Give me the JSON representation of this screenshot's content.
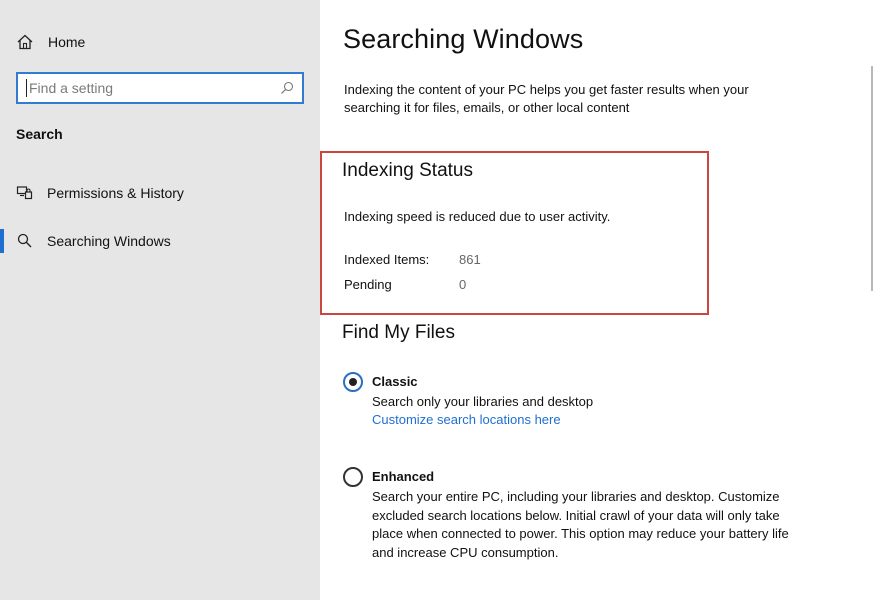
{
  "sidebar": {
    "home_label": "Home",
    "search_placeholder": "Find a setting",
    "section_title": "Search",
    "items": [
      {
        "label": "Permissions & History",
        "icon": "permissions-icon",
        "active": false
      },
      {
        "label": "Searching Windows",
        "icon": "search-icon",
        "active": true
      }
    ]
  },
  "main": {
    "title": "Searching Windows",
    "intro": "Indexing the content of your PC helps you get faster results when your searching it for files, emails, or other local content",
    "indexing_status": {
      "heading": "Indexing Status",
      "message": "Indexing speed is reduced due to user activity.",
      "indexed_items_label": "Indexed Items:",
      "indexed_items_value": "861",
      "pending_label": "Pending",
      "pending_value": "0"
    },
    "find_my_files": {
      "heading": "Find My Files",
      "options": [
        {
          "title": "Classic",
          "description": "Search only your libraries and desktop",
          "link": "Customize search locations here",
          "selected": true
        },
        {
          "title": "Enhanced",
          "description": "Search your entire PC, including your libraries and desktop. Customize excluded search locations below. Initial crawl of your data will only take place when connected to power. This option may reduce your battery life and increase CPU consumption.",
          "selected": false
        }
      ]
    }
  },
  "colors": {
    "accent": "#1f6fd1",
    "highlight_border": "#c9473e",
    "sidebar_bg": "#e6e6e6"
  }
}
